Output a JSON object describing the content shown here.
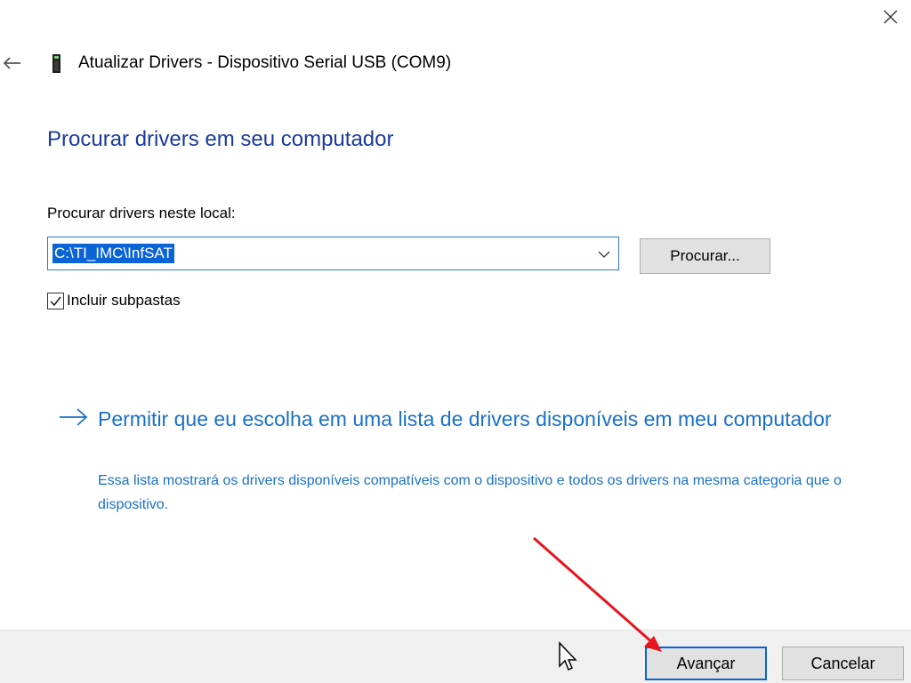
{
  "window": {
    "title": "Atualizar Drivers - Dispositivo Serial USB (COM9)",
    "close_icon": "close-icon",
    "back_icon": "back-arrow-icon",
    "device_icon": "usb-device-icon"
  },
  "main": {
    "heading": "Procurar drivers em seu computador",
    "location_label": "Procurar drivers neste local:",
    "path_value": "C:\\TI_IMC\\InfSAT",
    "browse_label": "Procurar...",
    "include_subfolders_label": "Incluir subpastas",
    "include_subfolders_checked": true,
    "choose_link": {
      "title": "Permitir que eu escolha em uma lista de drivers disponíveis em meu computador",
      "description": "Essa lista mostrará os drivers disponíveis compatíveis com o dispositivo e todos os drivers na mesma categoria que o dispositivo."
    }
  },
  "footer": {
    "next_label": "Avançar",
    "cancel_label": "Cancelar"
  },
  "colors": {
    "heading": "#1a3a9c",
    "link": "#1a70c8",
    "selection": "#0a64d6",
    "annotation_arrow": "#e8141e"
  }
}
